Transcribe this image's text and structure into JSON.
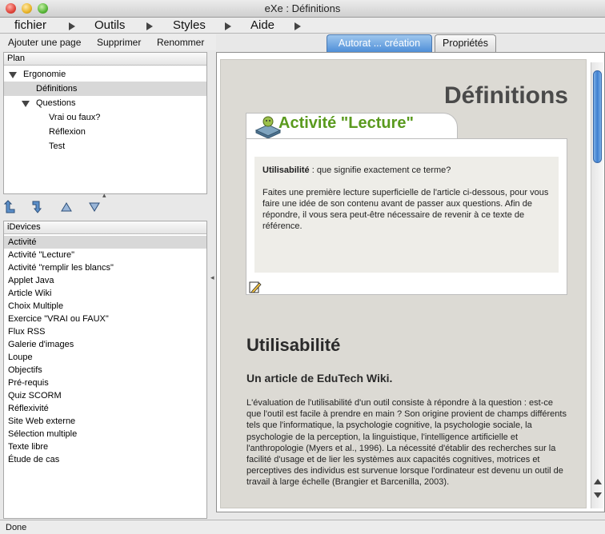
{
  "window": {
    "title": "eXe : Définitions"
  },
  "menubar": {
    "items": [
      "fichier",
      "Outils",
      "Styles",
      "Aide"
    ]
  },
  "toolbar": {
    "add_page": "Ajouter une page",
    "delete": "Supprimer",
    "rename": "Renommer"
  },
  "plan": {
    "header": "Plan",
    "nodes": [
      {
        "label": "Ergonomie",
        "expanded": true
      },
      {
        "label": "Définitions",
        "selected": true
      },
      {
        "label": "Questions",
        "expanded": true
      },
      {
        "label": "Vrai ou faux?"
      },
      {
        "label": "Réflexion"
      },
      {
        "label": "Test"
      }
    ]
  },
  "move_buttons": {
    "icons": [
      "promote-icon",
      "demote-icon",
      "move-up-icon",
      "move-down-icon"
    ]
  },
  "idevices": {
    "header": "iDevices",
    "items": [
      "Activité",
      "Activité \"Lecture\"",
      "Activité \"remplir les blancs\"",
      "Applet Java",
      "Article Wiki",
      "Choix Multiple",
      "Exercice \"VRAI ou FAUX\"",
      "Flux RSS",
      "Galerie d'images",
      "Loupe",
      "Objectifs",
      "Pré-requis",
      "Quiz SCORM",
      "Réflexivité",
      "Site Web externe",
      "Sélection multiple",
      "Texte libre",
      "Étude de cas"
    ],
    "selected_index": 0
  },
  "tabs": {
    "authoring": "Autorat ... création",
    "properties": "Propriétés"
  },
  "content": {
    "page_title": "Définitions",
    "idevice": {
      "title": "Activité \"Lecture\"",
      "term": "Utilisabilité",
      "question": " : que signifie exactement ce terme?",
      "instructions": "Faites une première lecture superficielle de l'article ci-dessous, pour vous faire une idée de son contenu avant de passer aux questions. Afin de répondre, il vous sera peut-être nécessaire de revenir à ce texte de référence."
    },
    "article": {
      "heading": "Utilisabilité",
      "subheading": "Un article de EduTech Wiki.",
      "body": "L'évaluation de l'utilisabilité d'un outil consiste à répondre à la question : est-ce que l'outil est facile à prendre en main ? Son origine provient de champs différents tels que l'informatique, la psychologie cognitive, la psychologie sociale, la psychologie de la perception, la linguistique, l'intelligence artificielle et l'anthropologie (Myers et al., 1996). La nécessité d'établir des recherches sur la facilité d'usage et de lier les systèmes aux capacités cognitives, motrices et perceptives des individus est survenue lorsque l'ordinateur est devenu un outil de travail à large échelle (Brangier et Barcenilla, 2003)."
    }
  },
  "statusbar": {
    "text": "Done"
  },
  "colors": {
    "accent_tab": "#4f8fd8",
    "idevice_title": "#5a9a1e",
    "page_title": "#4a4a4a"
  }
}
